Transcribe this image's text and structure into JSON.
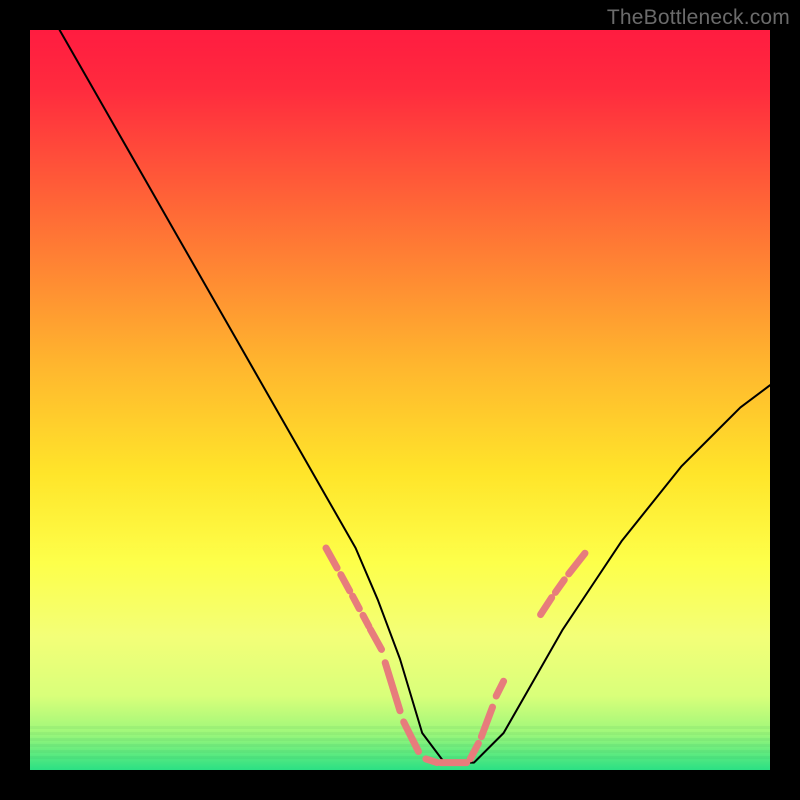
{
  "watermark": "TheBottleneck.com",
  "chart_data": {
    "type": "line",
    "title": "",
    "xlabel": "",
    "ylabel": "",
    "xlim": [
      0,
      100
    ],
    "ylim": [
      0,
      100
    ],
    "background_gradient": {
      "top": "#ff1f3f",
      "mid_upper": "#ff9e2a",
      "mid": "#ffe52a",
      "lower": "#f7ff6a",
      "bottom": "#29e083"
    },
    "series": [
      {
        "name": "bottleneck-curve",
        "stroke": "#000000",
        "x": [
          4,
          8,
          12,
          16,
          20,
          24,
          28,
          32,
          36,
          40,
          44,
          47,
          50,
          53,
          56,
          60,
          64,
          68,
          72,
          76,
          80,
          84,
          88,
          92,
          96,
          100
        ],
        "y": [
          100,
          93,
          86,
          79,
          72,
          65,
          58,
          51,
          44,
          37,
          30,
          23,
          15,
          5,
          1,
          1,
          5,
          12,
          19,
          25,
          31,
          36,
          41,
          45,
          49,
          52
        ]
      }
    ],
    "highlight_segments": {
      "color": "#e77c7c",
      "stroke_width": 7,
      "segments": [
        {
          "x": [
            40,
            41.5
          ],
          "y": [
            30,
            27.3
          ]
        },
        {
          "x": [
            42,
            43.2
          ],
          "y": [
            26.4,
            24.2
          ]
        },
        {
          "x": [
            43.6,
            44.5
          ],
          "y": [
            23.5,
            21.8
          ]
        },
        {
          "x": [
            45,
            45.8
          ],
          "y": [
            20.9,
            19.4
          ]
        },
        {
          "x": [
            46,
            47.5
          ],
          "y": [
            19.0,
            16.3
          ]
        },
        {
          "x": [
            48,
            50
          ],
          "y": [
            14.5,
            8
          ]
        },
        {
          "x": [
            50.5,
            52.5
          ],
          "y": [
            6.5,
            2.5
          ]
        },
        {
          "x": [
            53.5,
            55
          ],
          "y": [
            1.5,
            1
          ]
        },
        {
          "x": [
            55.5,
            59
          ],
          "y": [
            1,
            1
          ]
        },
        {
          "x": [
            59.5,
            60.6
          ],
          "y": [
            1.5,
            3.6
          ]
        },
        {
          "x": [
            61,
            62.5
          ],
          "y": [
            4.5,
            8.5
          ]
        },
        {
          "x": [
            63,
            64
          ],
          "y": [
            10,
            12
          ]
        },
        {
          "x": [
            69,
            70.5
          ],
          "y": [
            21,
            23.3
          ]
        },
        {
          "x": [
            71,
            72.2
          ],
          "y": [
            24,
            25.7
          ]
        },
        {
          "x": [
            72.8,
            75
          ],
          "y": [
            26.5,
            29.3
          ]
        }
      ]
    }
  }
}
